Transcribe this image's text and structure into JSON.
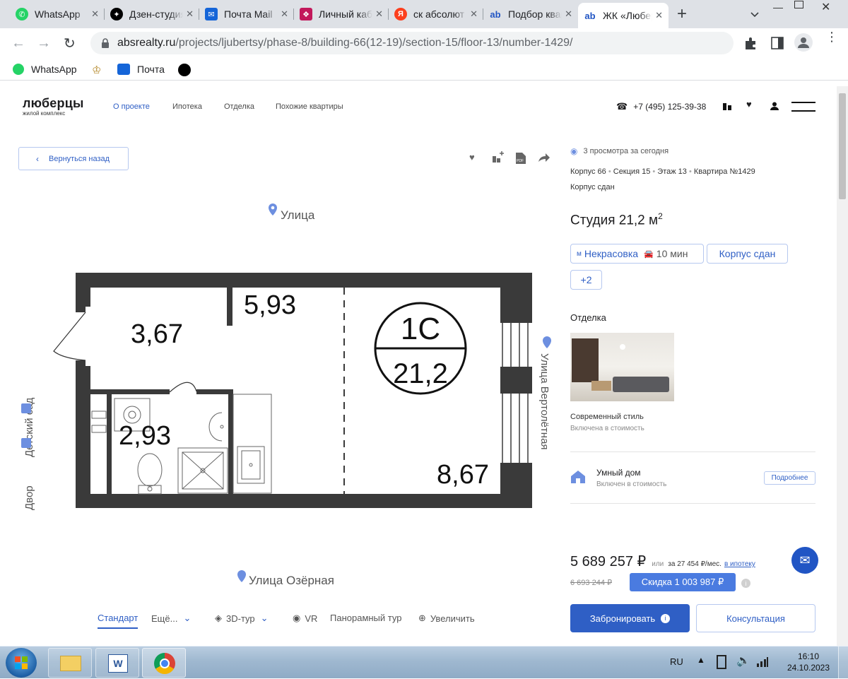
{
  "browser": {
    "tabs": [
      {
        "title": "WhatsApp",
        "icon": "whatsapp-icon",
        "color": "#25d366"
      },
      {
        "title": "Дзен-студия",
        "icon": "dzen-icon",
        "color": "#000000"
      },
      {
        "title": "Почта Mail",
        "icon": "mail-icon",
        "color": "#1565d8"
      },
      {
        "title": "Личный кабинет",
        "icon": "cabinet-icon",
        "color": "#c2185b"
      },
      {
        "title": "ск абсолют",
        "icon": "yandex-icon",
        "color": "#fc3f1d"
      },
      {
        "title": "Подбор квартир",
        "icon": "abs-icon",
        "color": "#2155c4"
      },
      {
        "title": "ЖК «Люберцы»",
        "icon": "abs-icon",
        "color": "#2155c4",
        "active": true
      }
    ],
    "new_tab": "+",
    "url_host": "absrealty.ru",
    "url_path": "/projects/ljubertsy/phase-8/building-66(12-19)/section-15/floor-13/number-1429/",
    "bookmarks": [
      "WhatsApp",
      "",
      "Почта",
      ""
    ]
  },
  "site": {
    "logo_title": "люберцы",
    "logo_subtitle": "жилой комплекс",
    "nav": [
      "О проекте",
      "Ипотека",
      "Отделка",
      "Похожие квартиры"
    ],
    "phone": "+7 (495) 125-39-38",
    "back_label": "Вернуться назад"
  },
  "plan": {
    "street_top": "Улица",
    "street_bottom": "Улица Озёрная",
    "street_right": "Улица Вертолётная",
    "left_kindergarten": "Детский сад",
    "left_yard": "Двор",
    "rooms": [
      "3,67",
      "5,93",
      "2,93",
      "8,67"
    ],
    "type_label": "1С",
    "type_area": "21,2"
  },
  "view_tabs": [
    "Стандарт",
    "Ещё...",
    "3D-тур",
    "VR",
    "Панорамный тур",
    "Увеличить"
  ],
  "listing": {
    "views": "3 просмотра за сегодня",
    "building": "Корпус 66",
    "section": "Секция 15",
    "floor": "Этаж 13",
    "apartment": "Квартира №1429",
    "status": "Корпус сдан",
    "title": "Студия 21,2 м",
    "title_sup": "2",
    "metro": "Некрасовка",
    "metro_time": "10 мин",
    "status_chip": "Корпус сдан",
    "more_chip": "+2",
    "finish_heading": "Отделка",
    "finish_name": "Современный стиль",
    "finish_note": "Включена в стоимость",
    "smart_title": "Умный дом",
    "smart_note": "Включен в стоимость",
    "smart_button": "Подробнее",
    "price": "5 689 257 ₽",
    "or": "или",
    "monthly": "за 27 454 ₽/мес.",
    "mortgage_link": "в ипотеку",
    "old_price": "6 693 244 ₽",
    "discount": "Скидка 1 003 987 ₽",
    "book_button": "Забронировать",
    "consult_button": "Консультация"
  },
  "taskbar": {
    "lang": "RU",
    "time": "16:10",
    "date": "24.10.2023"
  },
  "colors": {
    "accent": "#2f5fc5",
    "button_bg": "#2f5fc5",
    "discount_bg": "#4a7be0",
    "wall": "#3a3a3a"
  }
}
